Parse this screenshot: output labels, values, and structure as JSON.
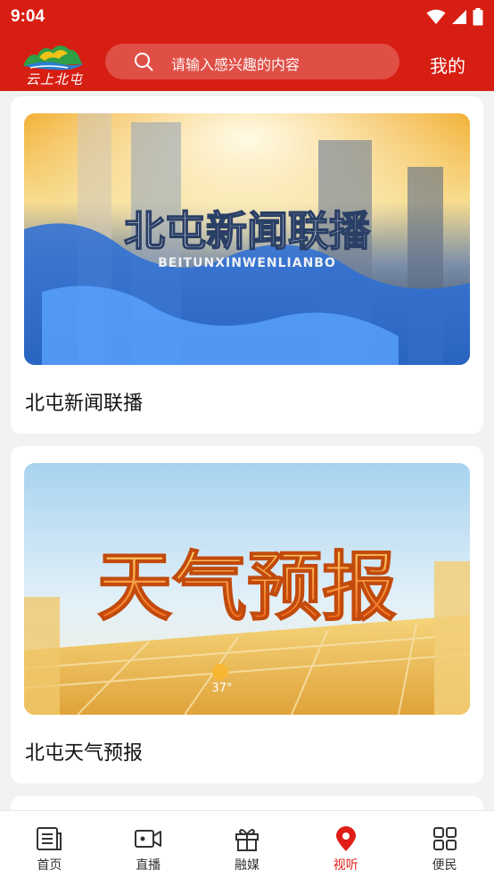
{
  "status_bar": {
    "time": "9:04"
  },
  "header": {
    "logo_text": "云上北屯",
    "search_placeholder": "请输入感兴趣的内容",
    "mine_label": "我的"
  },
  "feed": {
    "cards": [
      {
        "title": "北屯新闻联播",
        "thumb_title": "北屯新闻联播",
        "thumb_subtitle": "BEITUNXINWENLIANBO"
      },
      {
        "title": "北屯天气预报",
        "thumb_title": "天气预报",
        "thumb_temp": "37°"
      }
    ]
  },
  "bottom_nav": {
    "items": [
      {
        "label": "首页",
        "icon": "news-icon"
      },
      {
        "label": "直播",
        "icon": "video-camera-icon"
      },
      {
        "label": "融媒",
        "icon": "gift-icon"
      },
      {
        "label": "视听",
        "icon": "location-pin-icon"
      },
      {
        "label": "便民",
        "icon": "grid-icon"
      }
    ],
    "active_index": 3
  },
  "colors": {
    "brand_red": "#d71e13",
    "active_red": "#e01d16"
  }
}
